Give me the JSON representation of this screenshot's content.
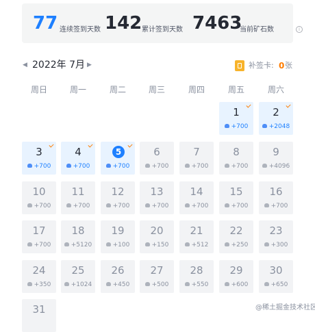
{
  "stats": [
    {
      "value": "77",
      "label": "连续签到天数"
    },
    {
      "value": "142",
      "label": "累计签到天数"
    },
    {
      "value": "7463",
      "label": "当前矿石数"
    }
  ],
  "info_icon": "info-icon",
  "calendar": {
    "month_label": "2022年 7月",
    "prev_icon": "chevron-left-icon",
    "next_icon": "chevron-right-icon",
    "makeup_card": {
      "label": "补签卡:",
      "count": "0",
      "unit": "张",
      "icon": "makeup-card-icon"
    },
    "weekdays": [
      "周日",
      "周一",
      "周二",
      "周三",
      "周四",
      "周五",
      "周六"
    ],
    "days": [
      {
        "day": "1",
        "reward": "+700",
        "signed": true
      },
      {
        "day": "2",
        "reward": "+2048",
        "signed": true
      },
      {
        "day": "3",
        "reward": "+700",
        "signed": true
      },
      {
        "day": "4",
        "reward": "+700",
        "signed": true
      },
      {
        "day": "5",
        "reward": "+700",
        "signed": true,
        "today": true
      },
      {
        "day": "6",
        "reward": "+700",
        "signed": false
      },
      {
        "day": "7",
        "reward": "+700",
        "signed": false
      },
      {
        "day": "8",
        "reward": "+700",
        "signed": false
      },
      {
        "day": "9",
        "reward": "+4096",
        "signed": false
      },
      {
        "day": "10",
        "reward": "+700",
        "signed": false
      },
      {
        "day": "11",
        "reward": "+700",
        "signed": false
      },
      {
        "day": "12",
        "reward": "+700",
        "signed": false
      },
      {
        "day": "13",
        "reward": "+700",
        "signed": false
      },
      {
        "day": "14",
        "reward": "+700",
        "signed": false
      },
      {
        "day": "15",
        "reward": "+700",
        "signed": false
      },
      {
        "day": "16",
        "reward": "+700",
        "signed": false
      },
      {
        "day": "17",
        "reward": "+700",
        "signed": false
      },
      {
        "day": "18",
        "reward": "+5120",
        "signed": false
      },
      {
        "day": "19",
        "reward": "+100",
        "signed": false
      },
      {
        "day": "20",
        "reward": "+150",
        "signed": false
      },
      {
        "day": "21",
        "reward": "+512",
        "signed": false
      },
      {
        "day": "22",
        "reward": "+250",
        "signed": false
      },
      {
        "day": "23",
        "reward": "+300",
        "signed": false
      },
      {
        "day": "24",
        "reward": "+350",
        "signed": false
      },
      {
        "day": "25",
        "reward": "+1024",
        "signed": false
      },
      {
        "day": "26",
        "reward": "+450",
        "signed": false
      },
      {
        "day": "27",
        "reward": "+500",
        "signed": false
      },
      {
        "day": "28",
        "reward": "+550",
        "signed": false
      },
      {
        "day": "29",
        "reward": "+600",
        "signed": false
      },
      {
        "day": "30",
        "reward": "+650",
        "signed": false
      },
      {
        "day": "31",
        "reward": "",
        "signed": false
      }
    ]
  },
  "watermark": "@稀土掘金技术社区",
  "colors": {
    "accent": "#1e80ff",
    "check": "#ff7d00",
    "signed_bg": "#e8f3ff",
    "unsigned_bg": "#f2f3f5"
  }
}
